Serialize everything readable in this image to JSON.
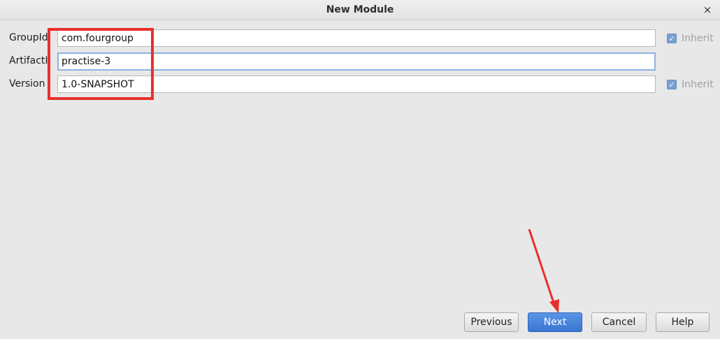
{
  "window": {
    "title": "New Module",
    "close_glyph": "×"
  },
  "form": {
    "group_id": {
      "label": "GroupId",
      "value": "com.fourgroup"
    },
    "artifact_id": {
      "label": "ArtifactId",
      "value": "practise-3"
    },
    "version": {
      "label": "Version",
      "value": "1.0-SNAPSHOT"
    },
    "inherit_label": "Inherit",
    "group_inherit_checked": true,
    "version_inherit_checked": true
  },
  "buttons": {
    "previous": "Previous",
    "next": "Next",
    "cancel": "Cancel",
    "help": "Help"
  },
  "annotations": {
    "highlight_color": "#e8302f",
    "arrow_color": "#e8302f"
  },
  "colors": {
    "primary_button": "#3a76d1",
    "checkbox": "#7a9fd2"
  }
}
